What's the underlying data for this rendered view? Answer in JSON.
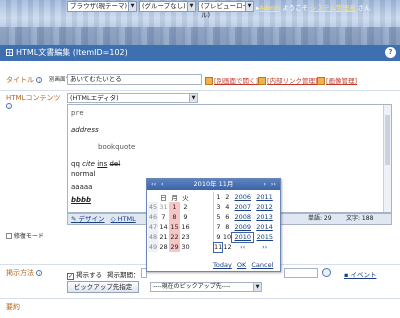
{
  "top": {
    "browser_select": "ブラウザ(現テーマ)",
    "group_select": "(グループなし)",
    "preview_select": "(プレビューロール)",
    "user_link": "Admin",
    "welcome": "ようこそ",
    "sysadmin": "システム管理者",
    "san": "さん"
  },
  "titlebar": {
    "title": "HTML文書編集 (ItemID=102)",
    "help": "?"
  },
  "title_field": {
    "label": "タイトル",
    "sublabel": "別画面で表示",
    "value": "あいてむたいとる"
  },
  "links": {
    "new_window": "[別画面で開く]",
    "link_manage": "[内部リンク管理]",
    "image_manage": "[画像管理]"
  },
  "contents": {
    "label": "HTMLコンテンツ",
    "editor_select": "(HTMLエディタ)"
  },
  "editor_lines": {
    "pre": "pre",
    "address": "address",
    "blockquote": "bookquote",
    "qq": "qq",
    "cite": "cite",
    "ins": "ins",
    "del": "del",
    "normal": "normal",
    "aaaaa": "aaaaa",
    "bbbb": "bbbb"
  },
  "editor_toolbar": {
    "design": "デザイン",
    "html": "HTML",
    "word_count": "単語: 29",
    "char_count": "文字: 188"
  },
  "repair_mode": "修復モード",
  "display": {
    "label": "掲示方法",
    "checkbox_label": "掲示する",
    "period_label": "掲示期間：",
    "event_label": "イベント",
    "pickup_button": "ピックアップ先指定",
    "pickup_select": "----現在のピックアップ先----"
  },
  "summary_label": "要約",
  "calendar": {
    "title": "2010年 11月",
    "weekdays": [
      "日",
      "月",
      "火"
    ],
    "weeks": [
      "45",
      "46",
      "47",
      "48",
      "49"
    ],
    "days": [
      [
        "31",
        "1",
        "2"
      ],
      [
        "7",
        "8",
        "9"
      ],
      [
        "14",
        "15",
        "16"
      ],
      [
        "21",
        "22",
        "23"
      ],
      [
        "28",
        "29",
        "30"
      ]
    ],
    "months": [
      [
        "1",
        "2"
      ],
      [
        "3",
        "4"
      ],
      [
        "5",
        "6"
      ],
      [
        "7",
        "8"
      ],
      [
        "9",
        "10"
      ],
      [
        "11",
        "12"
      ]
    ],
    "years": [
      [
        "2006",
        "2011"
      ],
      [
        "2007",
        "2012"
      ],
      [
        "2008",
        "2013"
      ],
      [
        "2009",
        "2014"
      ],
      [
        "2010",
        "2015"
      ]
    ],
    "nav_prev": "‹‹",
    "nav_next": "››",
    "today": "Today",
    "ok": "OK",
    "cancel": "Cancel"
  }
}
